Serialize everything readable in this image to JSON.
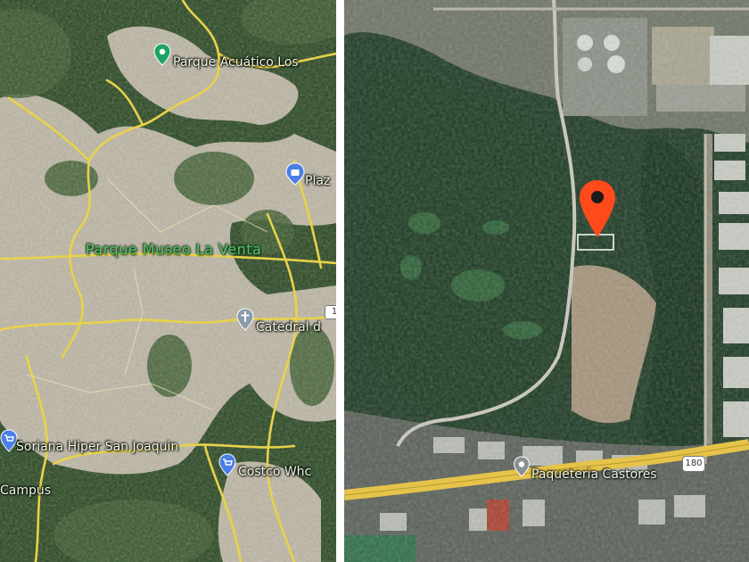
{
  "left_map": {
    "labels": {
      "parque_acuatico": "Parque Acuático Los",
      "plaza": "Plaz",
      "parque_museo": "Parque Museo La Venta",
      "catedral": "Catedral d",
      "soriana": "Soriana Hiper San Joaquin",
      "costco": "Costco Whc",
      "campus": "Campus"
    },
    "icons": {
      "parque_acuatico": "green-place-pin-icon",
      "plaza": "shopping-bag-pin-icon",
      "catedral": "church-pin-icon",
      "soriana": "shopping-cart-pin-icon",
      "costco": "shopping-cart-pin-icon"
    },
    "colors": {
      "road": "#e8d24a",
      "forest": "#1f3d1c",
      "urban": "#b9b3a2",
      "park_label": "#56c86a"
    },
    "shields": {
      "right_edge": "1"
    }
  },
  "right_map": {
    "labels": {
      "paqueteria": "Paqueteria Castores"
    },
    "highway_shield": "180",
    "icons": {
      "paqueteria": "place-pin-icon",
      "location": "red-location-marker-icon"
    },
    "colors": {
      "marker": "#ff4a1c",
      "highway": "#e6c34a",
      "vegetation": "#1c3a22"
    }
  }
}
